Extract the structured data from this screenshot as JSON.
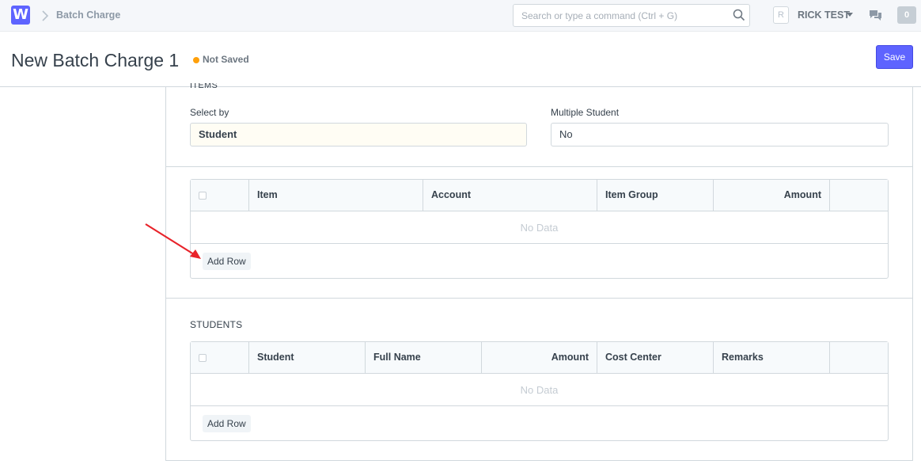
{
  "navbar": {
    "logo": "W",
    "breadcrumb": "Batch Charge",
    "search_placeholder": "Search or type a command (Ctrl + G)",
    "avatar_initial": "R",
    "user_name": "RICK TEST",
    "notification_count": "0"
  },
  "page": {
    "title": "New Batch Charge 1",
    "status": "Not Saved",
    "save_label": "Save"
  },
  "items_section": {
    "label": "ITEMS",
    "select_by_label": "Select by",
    "select_by_value": "Student",
    "multiple_student_label": "Multiple Student",
    "multiple_student_value": "No",
    "columns": [
      "Item",
      "Account",
      "Item Group",
      "Amount"
    ],
    "empty_text": "No Data",
    "add_row_label": "Add Row"
  },
  "students_section": {
    "label": "STUDENTS",
    "columns": [
      "Student",
      "Full Name",
      "Amount",
      "Cost Center",
      "Remarks"
    ],
    "empty_text": "No Data",
    "add_row_label": "Add Row"
  },
  "colors": {
    "primary": "#5e64ff",
    "status_dot": "#ffa00a",
    "annotation_arrow": "#e8232a"
  }
}
